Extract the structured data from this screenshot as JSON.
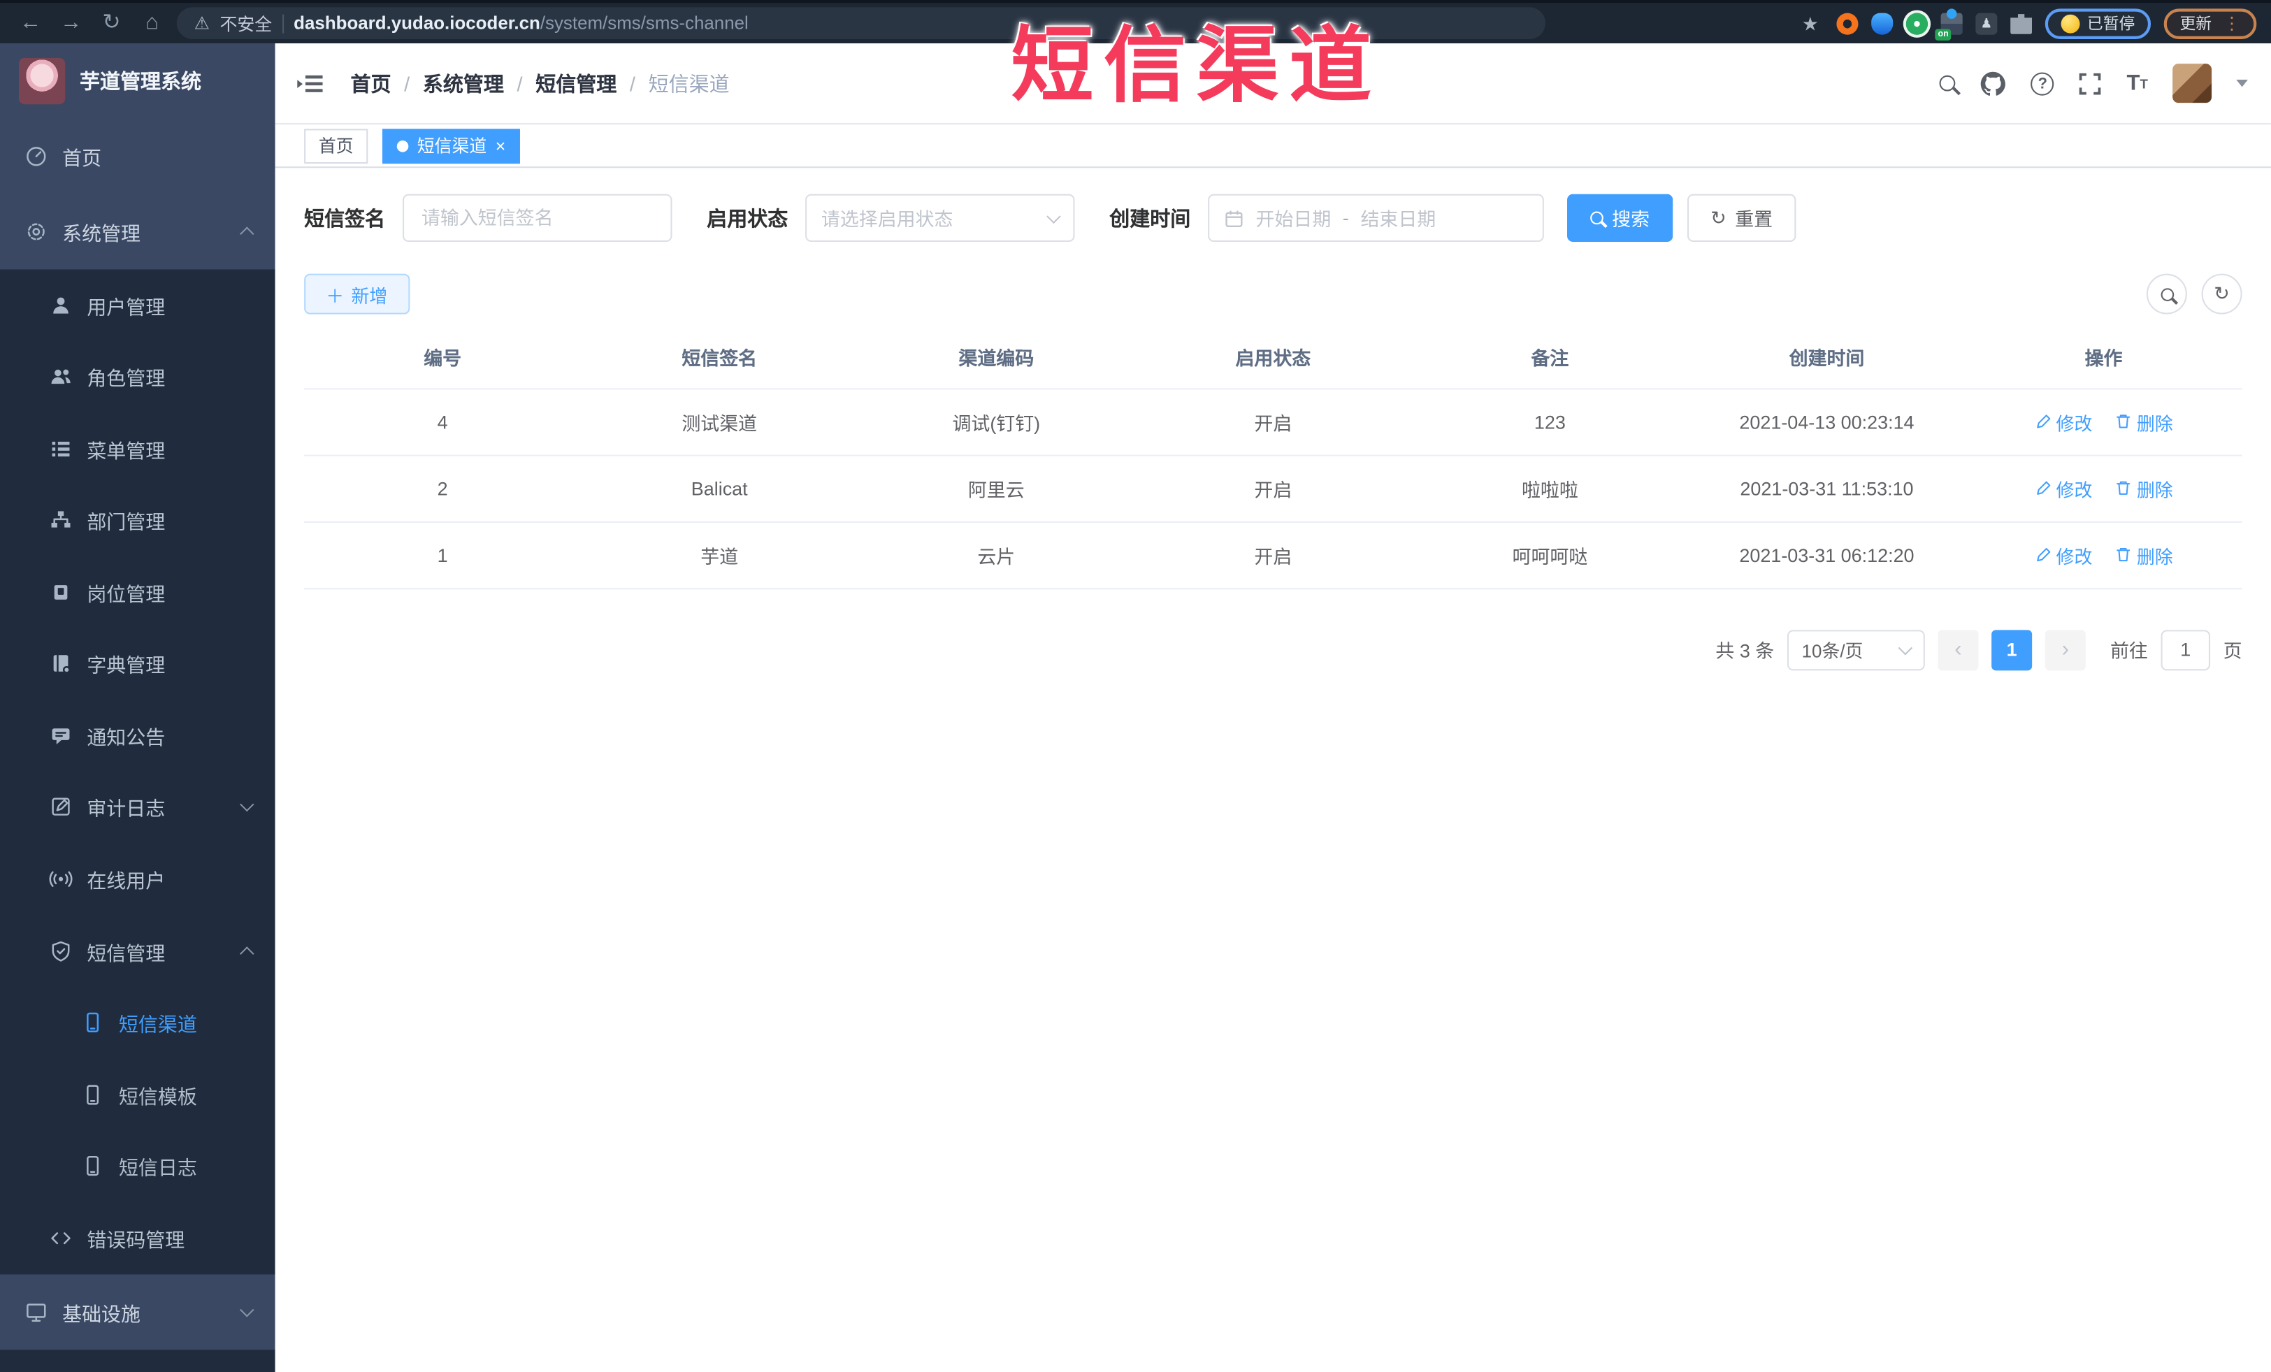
{
  "browser": {
    "security_label": "不安全",
    "url_domain": "dashboard.yudao.iocoder.cn",
    "url_path": "/system/sms/sms-channel",
    "extension_badge": "on",
    "paused_label": "已暂停",
    "update_label": "更新"
  },
  "watermark": {
    "text": "短信渠道",
    "color": "#f43b5c"
  },
  "sidebar": {
    "title": "芋道管理系统",
    "items": {
      "home": "首页",
      "system": "系统管理",
      "user": "用户管理",
      "role": "角色管理",
      "menu": "菜单管理",
      "dept": "部门管理",
      "post": "岗位管理",
      "dict": "字典管理",
      "notice": "通知公告",
      "audit": "审计日志",
      "online": "在线用户",
      "sms": "短信管理",
      "sms_channel": "短信渠道",
      "sms_template": "短信模板",
      "sms_log": "短信日志",
      "errcode": "错误码管理",
      "infra": "基础设施"
    }
  },
  "breadcrumb": {
    "items": [
      "首页",
      "系统管理",
      "短信管理",
      "短信渠道"
    ],
    "separator": "/"
  },
  "tags": {
    "home": "首页",
    "active": "短信渠道",
    "close": "×"
  },
  "filters": {
    "sign_label": "短信签名",
    "sign_placeholder": "请输入短信签名",
    "status_label": "启用状态",
    "status_placeholder": "请选择启用状态",
    "time_label": "创建时间",
    "start_placeholder": "开始日期",
    "range_separator": "-",
    "end_placeholder": "结束日期",
    "search_label": "搜索",
    "reset_label": "重置"
  },
  "toolbar": {
    "add_label": "新增"
  },
  "table": {
    "columns": [
      "编号",
      "短信签名",
      "渠道编码",
      "启用状态",
      "备注",
      "创建时间",
      "操作"
    ],
    "rows": [
      {
        "id": "4",
        "signature": "测试渠道",
        "code": "调试(钉钉)",
        "status": "开启",
        "remark": "123",
        "created": "2021-04-13 00:23:14"
      },
      {
        "id": "2",
        "signature": "Balicat",
        "code": "阿里云",
        "status": "开启",
        "remark": "啦啦啦",
        "created": "2021-03-31 11:53:10"
      },
      {
        "id": "1",
        "signature": "芋道",
        "code": "云片",
        "status": "开启",
        "remark": "呵呵呵哒",
        "created": "2021-03-31 06:12:20"
      }
    ],
    "edit_label": "修改",
    "delete_label": "删除"
  },
  "pagination": {
    "total": "共 3 条",
    "page_size": "10条/页",
    "prev": "‹",
    "current": "1",
    "next": "›",
    "goto_label": "前往",
    "goto_value": "1",
    "unit_label": "页"
  },
  "colors": {
    "accent": "#409EFF",
    "sidebar_root_bg": "#3a4863",
    "sidebar_sub_bg": "#202c3d",
    "watermark_red": "#f43b5c",
    "browser_bar_bg": "#1d2733"
  }
}
